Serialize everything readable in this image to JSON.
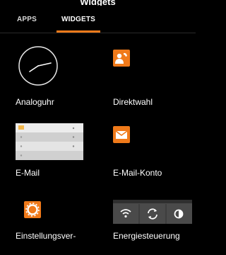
{
  "header": {
    "title": "Widgets"
  },
  "tabs": [
    {
      "label": "APPS",
      "active": false
    },
    {
      "label": "WIDGETS",
      "active": true
    }
  ],
  "accent_color": "#f07a1a",
  "widgets": [
    {
      "label": "Analoguhr",
      "icon": "analog-clock-icon"
    },
    {
      "label": "Direktwahl",
      "icon": "direct-dial-icon"
    },
    {
      "label": "E-Mail",
      "icon": "email-preview-icon"
    },
    {
      "label": "E-Mail-Konto",
      "icon": "envelope-icon"
    },
    {
      "label": "Einstellungsver-",
      "icon": "gear-icon"
    },
    {
      "label": "Energiesteuerung",
      "icon": "power-control-icon"
    }
  ]
}
